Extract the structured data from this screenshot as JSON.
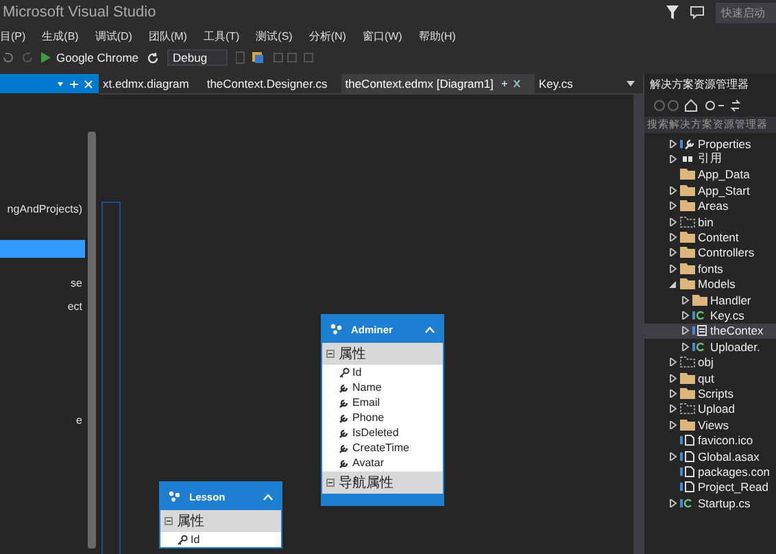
{
  "window": {
    "title": "Microsoft Visual Studio",
    "quick_launch": "快速启动"
  },
  "menu": [
    "目(P)",
    "生成(B)",
    "调试(D)",
    "团队(M)",
    "工具(T)",
    "测试(S)",
    "分析(N)",
    "窗口(W)",
    "帮助(H)"
  ],
  "toolbar": {
    "browser": "Google Chrome",
    "configuration": "Debug"
  },
  "left_panel": {
    "items": [
      {
        "label": "ngAndProjects)",
        "selected": false
      },
      {
        "selected": true
      },
      {
        "label": "se",
        "selected": false
      },
      {
        "label": "ect",
        "selected": false
      },
      {
        "label": "e",
        "selected": false
      }
    ]
  },
  "tabs": [
    {
      "label": "xt.edmx.diagram",
      "selected": false
    },
    {
      "label": "theContext.Designer.cs",
      "selected": false
    },
    {
      "label": "theContext.edmx [Diagram1]",
      "selected": true
    },
    {
      "label": "Key.cs",
      "selected": false
    }
  ],
  "entities": [
    {
      "name": "Adminer",
      "section": "属性",
      "properties": [
        {
          "name": "Id",
          "key": true
        },
        {
          "name": "Name",
          "key": false
        },
        {
          "name": "Email",
          "key": false
        },
        {
          "name": "Phone",
          "key": false
        },
        {
          "name": "IsDeleted",
          "key": false
        },
        {
          "name": "CreateTime",
          "key": false
        },
        {
          "name": "Avatar",
          "key": false
        }
      ],
      "nav_section": "导航属性"
    },
    {
      "name": "Lesson",
      "section": "属性",
      "properties": [
        {
          "name": "Id",
          "key": true
        }
      ]
    }
  ],
  "solution_explorer": {
    "title": "解决方案资源管理器",
    "search": {
      "placeholder": "搜索解决方案资源管理器"
    },
    "items": [
      {
        "label": "Properties",
        "kind": "wrench",
        "expanded": false
      },
      {
        "label": "引用",
        "kind": "refs",
        "expanded": false
      },
      {
        "label": "App_Data",
        "kind": "folder"
      },
      {
        "label": "App_Start",
        "kind": "folder",
        "expanded": false
      },
      {
        "label": "Areas",
        "kind": "folder",
        "expanded": false
      },
      {
        "label": "bin",
        "kind": "ghost",
        "expanded": false
      },
      {
        "label": "Content",
        "kind": "folder",
        "expanded": false
      },
      {
        "label": "Controllers",
        "kind": "folder",
        "expanded": false
      },
      {
        "label": "fonts",
        "kind": "folder",
        "expanded": false
      },
      {
        "label": "Models",
        "kind": "folder",
        "expanded": true,
        "children": [
          {
            "label": "Handler",
            "kind": "folder",
            "expanded": false,
            "selected": false
          },
          {
            "label": "Key.cs",
            "kind": "cs",
            "expanded": false,
            "selected": false
          },
          {
            "label": "theContex",
            "kind": "edmx",
            "expanded": false,
            "selected": true
          },
          {
            "label": "Uploader.",
            "kind": "cs",
            "expanded": false,
            "selected": false
          }
        ]
      },
      {
        "label": "obj",
        "kind": "ghost",
        "expanded": false
      },
      {
        "label": "qut",
        "kind": "folder",
        "expanded": false
      },
      {
        "label": "Scripts",
        "kind": "folder",
        "expanded": false
      },
      {
        "label": "Upload",
        "kind": "ghost",
        "expanded": false
      },
      {
        "label": "Views",
        "kind": "folder",
        "expanded": false
      },
      {
        "label": "favicon.ico",
        "kind": "file"
      },
      {
        "label": "Global.asax",
        "kind": "file",
        "expanded": false
      },
      {
        "label": "packages.con",
        "kind": "file"
      },
      {
        "label": "Project_Read",
        "kind": "file"
      },
      {
        "label": "Startup.cs",
        "kind": "cs",
        "expanded": false
      }
    ]
  }
}
